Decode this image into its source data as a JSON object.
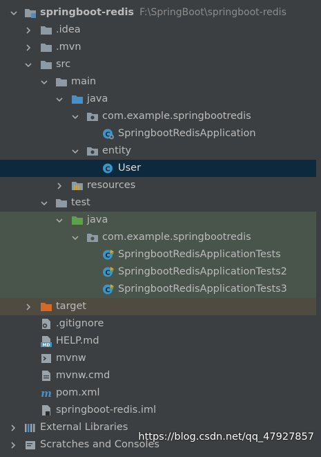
{
  "project": {
    "name": "springboot-redis",
    "path": "F:\\SpringBoot\\springboot-redis"
  },
  "nodes": {
    "idea": ".idea",
    "mvn": ".mvn",
    "src": "src",
    "main": "main",
    "java": "java",
    "pkg_main": "com.example.springbootredis",
    "app": "SpringbootRedisApplication",
    "entity": "entity",
    "user": "User",
    "resources": "resources",
    "test": "test",
    "test_java": "java",
    "pkg_test": "com.example.springbootredis",
    "tests1": "SpringbootRedisApplicationTests",
    "tests2": "SpringbootRedisApplicationTests2",
    "tests3": "SpringbootRedisApplicationTests3",
    "target": "target",
    "gitignore": ".gitignore",
    "help": "HELP.md",
    "mvnw": "mvnw",
    "mvnw_cmd": "mvnw.cmd",
    "pom": "pom.xml",
    "iml": "springboot-redis.iml",
    "external": "External Libraries",
    "scratches": "Scratches and Consoles"
  },
  "watermark": "https://blog.csdn.net/qq_47927857",
  "colors": {
    "background": "#3c3f41",
    "selection": "#0d293e",
    "test_root": "#49544a",
    "excluded": "#4f4b41",
    "folder": "#8d9aa4",
    "source_folder": "#4a8ec4",
    "test_folder": "#5fa04e",
    "excluded_folder": "#d46a26",
    "class_icon": "#3a95c8"
  }
}
